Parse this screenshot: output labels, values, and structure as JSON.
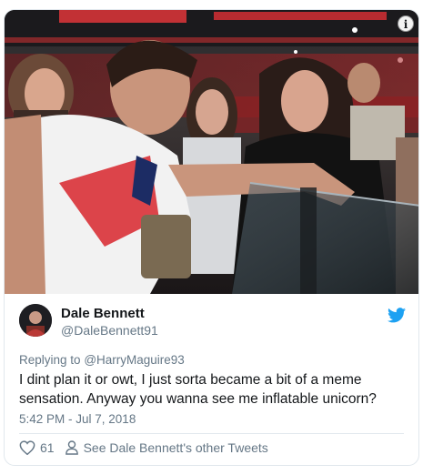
{
  "tweet": {
    "author_name": "Dale Bennett",
    "author_handle": "@DaleBennett91",
    "reply_prefix": "Replying to",
    "reply_handle": "@HarryMaguire93",
    "text": "I dint plan it or owt, I just sorta became a bit of a meme sensation. Anyway you wanna see me inflatable unicorn?",
    "timestamp": "5:42 PM - Jul 7, 2018",
    "likes": "61",
    "more_tweets_label": "See Dale Bennett's other Tweets"
  },
  "icons": {
    "info": "info-icon",
    "platform": "twitter-bird-icon",
    "like": "heart-icon",
    "profile": "person-icon"
  },
  "colors": {
    "twitter_blue": "#1da1f2",
    "secondary_text": "#657786",
    "border": "#e1e8ed"
  }
}
